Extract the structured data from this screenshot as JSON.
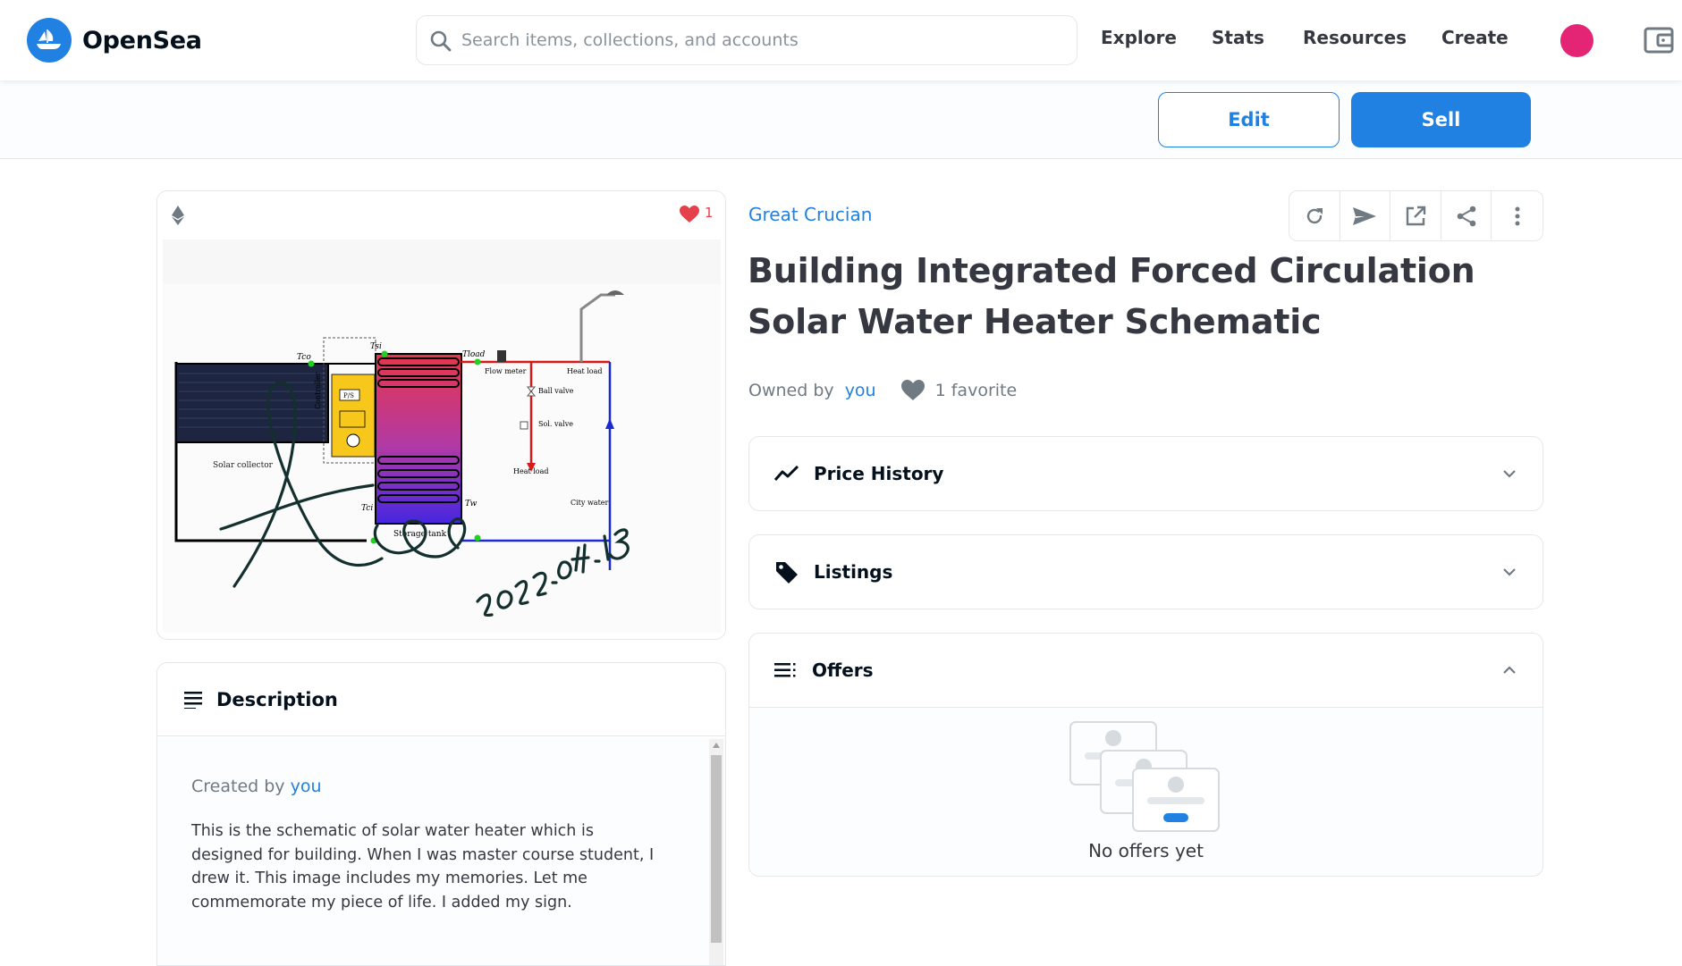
{
  "header": {
    "logo_text": "OpenSea",
    "search_placeholder": "Search items, collections, and accounts",
    "nav": [
      "Explore",
      "Stats",
      "Resources",
      "Create"
    ]
  },
  "actions": {
    "edit_label": "Edit",
    "sell_label": "Sell"
  },
  "image_card": {
    "favorite_count": "1",
    "artwork": {
      "labels": {
        "solar_collector": "Solar collector",
        "controller": "Controller",
        "ps": "P/S",
        "storage_tank": "Storage tank",
        "flow_meter": "Flow meter",
        "heat_load_top": "Heat load",
        "ball_valve": "Ball valve",
        "sol_valve": "Sol. valve",
        "heat_load_mid": "Heat load",
        "city_water": "City water",
        "t_co": "Tco",
        "t_si": "Tsi",
        "t_load": "Tload",
        "t_ci": "Tci",
        "t_w": "Tw"
      },
      "signature_date": "2022.04.15"
    }
  },
  "description": {
    "title": "Description",
    "created_by_prefix": "Created by",
    "created_by_link": "you",
    "text": "This is the schematic of solar water heater which is designed for building. When I was master course student, I drew it. This image includes my memories. Let me commemorate my piece of life. I added my sign."
  },
  "item": {
    "collection": "Great Crucian",
    "title": "Building Integrated Forced Circulation Solar Water Heater Schematic",
    "owned_by_prefix": "Owned by",
    "owned_by_link": "you",
    "favorites": "1 favorite"
  },
  "panels": {
    "price_history": "Price History",
    "listings": "Listings",
    "offers": "Offers",
    "no_offers": "No offers yet"
  },
  "icons": {
    "logo": "opensea-boat-icon",
    "search": "search-icon",
    "wallet": "wallet-icon",
    "refresh": "refresh-icon",
    "transfer": "send-icon",
    "external": "external-link-icon",
    "share": "share-icon",
    "more": "more-vertical-icon"
  },
  "colors": {
    "brand": "#2081e2",
    "heart": "#e5414c",
    "avatar": "#e42575"
  }
}
